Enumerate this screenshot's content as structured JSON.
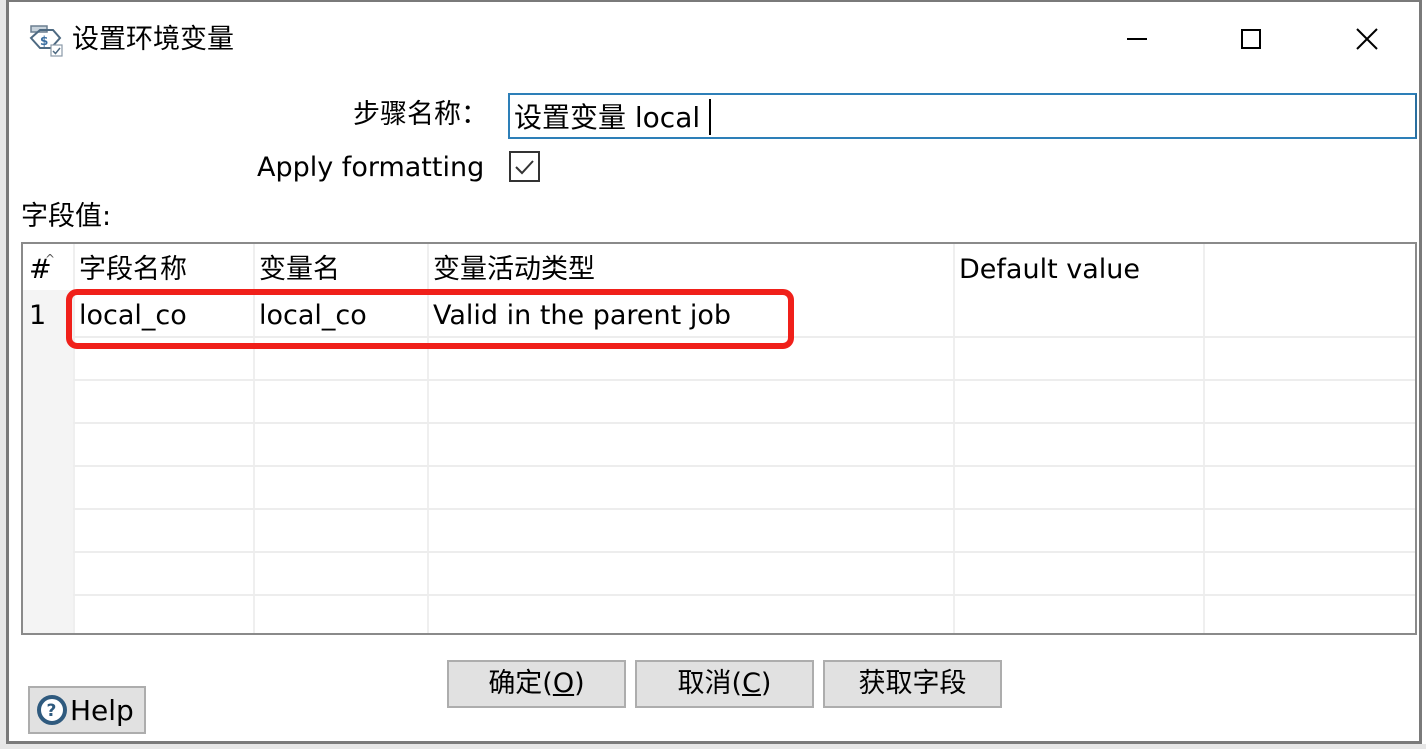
{
  "window": {
    "title": "设置环境变量",
    "icon": "set-variable-icon",
    "controls": {
      "minimize": "minimize-icon",
      "maximize": "maximize-icon",
      "close": "close-icon"
    }
  },
  "form": {
    "step_name_label": "步骤名称：",
    "step_name_value": "设置变量 local",
    "apply_formatting_label": "Apply formatting",
    "apply_formatting_checked": true,
    "fields_label": "字段值:"
  },
  "table": {
    "columns": [
      "#",
      "字段名称",
      "变量名",
      "变量活动类型",
      "Default value"
    ],
    "rows": [
      {
        "num": "1",
        "field_name": "local_co",
        "variable_name": "local_co",
        "scope": "Valid in the parent job",
        "default_value": ""
      }
    ],
    "empty_rows": 7
  },
  "annotation": {
    "color": "#f0201a",
    "target": "row 1"
  },
  "buttons": {
    "ok_text": "确定(",
    "ok_key": "O",
    "ok_tail": ")",
    "cancel_text": "取消(",
    "cancel_key": "C",
    "cancel_tail": ")",
    "get_fields": "获取字段",
    "help": "Help"
  },
  "colors": {
    "input_border": "#2d7fb8",
    "button_bg": "#e1e1e1",
    "highlight": "#f0201a"
  }
}
